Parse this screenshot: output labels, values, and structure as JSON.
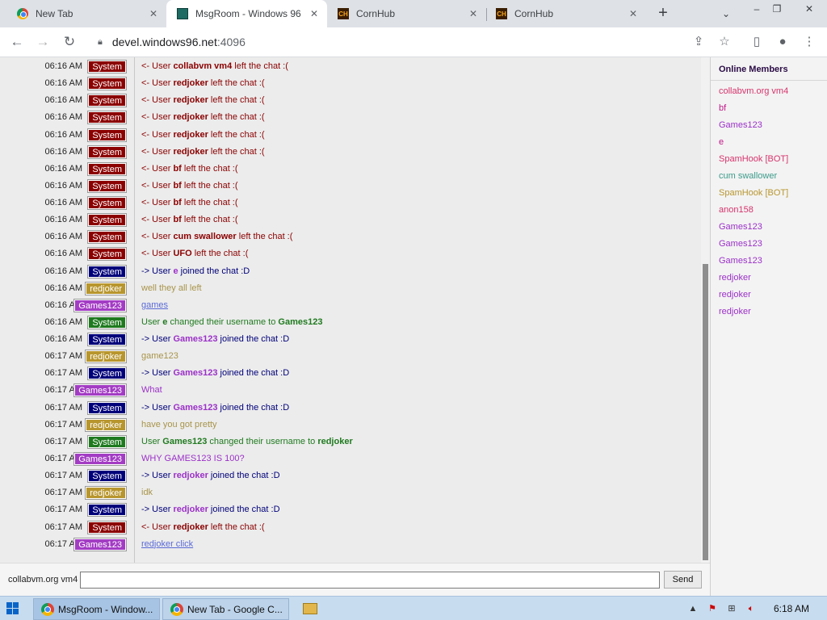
{
  "browser": {
    "tabs": [
      {
        "title": "New Tab",
        "favicon": "chrome-icon",
        "active": false
      },
      {
        "title": "MsgRoom - Windows 96",
        "favicon": "windows96-icon",
        "active": true
      },
      {
        "title": "CornHub",
        "favicon": "ch-icon",
        "active": false
      },
      {
        "title": "CornHub",
        "favicon": "ch-icon",
        "active": false
      }
    ],
    "url_host": "devel.windows96.net",
    "url_port": ":4096"
  },
  "chat": {
    "messages": [
      {
        "time": "06:16 AM",
        "sender": "System",
        "badge_color": "#8b0000",
        "text_color": "#8b0000",
        "parts": [
          {
            "t": "<- User "
          },
          {
            "t": "collabvm vm4",
            "b": true
          },
          {
            "t": " left the chat :("
          }
        ]
      },
      {
        "time": "06:16 AM",
        "sender": "System",
        "badge_color": "#8b0000",
        "text_color": "#8b0000",
        "parts": [
          {
            "t": "<- User "
          },
          {
            "t": "redjoker",
            "b": true
          },
          {
            "t": " left the chat :("
          }
        ]
      },
      {
        "time": "06:16 AM",
        "sender": "System",
        "badge_color": "#8b0000",
        "text_color": "#8b0000",
        "parts": [
          {
            "t": "<- User "
          },
          {
            "t": "redjoker",
            "b": true
          },
          {
            "t": " left the chat :("
          }
        ]
      },
      {
        "time": "06:16 AM",
        "sender": "System",
        "badge_color": "#8b0000",
        "text_color": "#8b0000",
        "parts": [
          {
            "t": "<- User "
          },
          {
            "t": "redjoker",
            "b": true
          },
          {
            "t": " left the chat :("
          }
        ]
      },
      {
        "time": "06:16 AM",
        "sender": "System",
        "badge_color": "#8b0000",
        "text_color": "#8b0000",
        "parts": [
          {
            "t": "<- User "
          },
          {
            "t": "redjoker",
            "b": true
          },
          {
            "t": " left the chat :("
          }
        ]
      },
      {
        "time": "06:16 AM",
        "sender": "System",
        "badge_color": "#8b0000",
        "text_color": "#8b0000",
        "parts": [
          {
            "t": "<- User "
          },
          {
            "t": "redjoker",
            "b": true
          },
          {
            "t": " left the chat :("
          }
        ]
      },
      {
        "time": "06:16 AM",
        "sender": "System",
        "badge_color": "#8b0000",
        "text_color": "#8b0000",
        "parts": [
          {
            "t": "<- User "
          },
          {
            "t": "bf",
            "b": true
          },
          {
            "t": " left the chat :("
          }
        ]
      },
      {
        "time": "06:16 AM",
        "sender": "System",
        "badge_color": "#8b0000",
        "text_color": "#8b0000",
        "parts": [
          {
            "t": "<- User "
          },
          {
            "t": "bf",
            "b": true
          },
          {
            "t": " left the chat :("
          }
        ]
      },
      {
        "time": "06:16 AM",
        "sender": "System",
        "badge_color": "#8b0000",
        "text_color": "#8b0000",
        "parts": [
          {
            "t": "<- User "
          },
          {
            "t": "bf",
            "b": true
          },
          {
            "t": " left the chat :("
          }
        ]
      },
      {
        "time": "06:16 AM",
        "sender": "System",
        "badge_color": "#8b0000",
        "text_color": "#8b0000",
        "parts": [
          {
            "t": "<- User "
          },
          {
            "t": "bf",
            "b": true
          },
          {
            "t": " left the chat :("
          }
        ]
      },
      {
        "time": "06:16 AM",
        "sender": "System",
        "badge_color": "#8b0000",
        "text_color": "#8b0000",
        "parts": [
          {
            "t": "<- User "
          },
          {
            "t": "cum swallower",
            "b": true
          },
          {
            "t": " left the chat :("
          }
        ]
      },
      {
        "time": "06:16 AM",
        "sender": "System",
        "badge_color": "#8b0000",
        "text_color": "#8b0000",
        "parts": [
          {
            "t": "<- User "
          },
          {
            "t": "UFO",
            "b": true
          },
          {
            "t": " left the chat :("
          }
        ]
      },
      {
        "time": "06:16 AM",
        "sender": "System",
        "badge_color": "#00007a",
        "text_color": "#00007a",
        "parts": [
          {
            "t": "-> User "
          },
          {
            "t": "e",
            "b": true,
            "c": "#9b30c8"
          },
          {
            "t": " joined the chat :D"
          }
        ]
      },
      {
        "time": "06:16 AM",
        "sender": "redjoker",
        "badge_color": "#b8962e",
        "text_color": "#a8944a",
        "parts": [
          {
            "t": "well they all left"
          }
        ]
      },
      {
        "time": "06:16 AM",
        "sender": "Games123",
        "badge_color": "#a33cc4",
        "text_color": "#5a6ad6",
        "parts": [
          {
            "t": "games",
            "u": true
          }
        ]
      },
      {
        "time": "06:16 AM",
        "sender": "System",
        "badge_color": "#1f7a1f",
        "text_color": "#1f7a1f",
        "parts": [
          {
            "t": "User "
          },
          {
            "t": "e",
            "b": true
          },
          {
            "t": " changed their username to "
          },
          {
            "t": "Games123",
            "b": true
          }
        ]
      },
      {
        "time": "06:16 AM",
        "sender": "System",
        "badge_color": "#00007a",
        "text_color": "#00007a",
        "parts": [
          {
            "t": "-> User "
          },
          {
            "t": "Games123",
            "b": true,
            "c": "#9b30c8"
          },
          {
            "t": " joined the chat :D"
          }
        ]
      },
      {
        "time": "06:17 AM",
        "sender": "redjoker",
        "badge_color": "#b8962e",
        "text_color": "#a8944a",
        "parts": [
          {
            "t": "game123"
          }
        ]
      },
      {
        "time": "06:17 AM",
        "sender": "System",
        "badge_color": "#00007a",
        "text_color": "#00007a",
        "parts": [
          {
            "t": "-> User "
          },
          {
            "t": "Games123",
            "b": true,
            "c": "#9b30c8"
          },
          {
            "t": " joined the chat :D"
          }
        ]
      },
      {
        "time": "06:17 AM",
        "sender": "Games123",
        "badge_color": "#a33cc4",
        "text_color": "#9b30c8",
        "parts": [
          {
            "t": "What"
          }
        ]
      },
      {
        "time": "06:17 AM",
        "sender": "System",
        "badge_color": "#00007a",
        "text_color": "#00007a",
        "parts": [
          {
            "t": "-> User "
          },
          {
            "t": "Games123",
            "b": true,
            "c": "#9b30c8"
          },
          {
            "t": " joined the chat :D"
          }
        ]
      },
      {
        "time": "06:17 AM",
        "sender": "redjoker",
        "badge_color": "#b8962e",
        "text_color": "#a8944a",
        "parts": [
          {
            "t": "have you got pretty"
          }
        ]
      },
      {
        "time": "06:17 AM",
        "sender": "System",
        "badge_color": "#1f7a1f",
        "text_color": "#1f7a1f",
        "parts": [
          {
            "t": "User "
          },
          {
            "t": "Games123",
            "b": true
          },
          {
            "t": " changed their username to "
          },
          {
            "t": "redjoker",
            "b": true
          }
        ]
      },
      {
        "time": "06:17 AM",
        "sender": "Games123",
        "badge_color": "#a33cc4",
        "text_color": "#9b30c8",
        "parts": [
          {
            "t": "WHY GAMES123 IS 100?"
          }
        ]
      },
      {
        "time": "06:17 AM",
        "sender": "System",
        "badge_color": "#00007a",
        "text_color": "#00007a",
        "parts": [
          {
            "t": "-> User "
          },
          {
            "t": "redjoker",
            "b": true,
            "c": "#9b30c8"
          },
          {
            "t": " joined the chat :D"
          }
        ]
      },
      {
        "time": "06:17 AM",
        "sender": "redjoker",
        "badge_color": "#b8962e",
        "text_color": "#a8944a",
        "parts": [
          {
            "t": "idk"
          }
        ]
      },
      {
        "time": "06:17 AM",
        "sender": "System",
        "badge_color": "#00007a",
        "text_color": "#00007a",
        "parts": [
          {
            "t": "-> User "
          },
          {
            "t": "redjoker",
            "b": true,
            "c": "#9b30c8"
          },
          {
            "t": " joined the chat :D"
          }
        ]
      },
      {
        "time": "06:17 AM",
        "sender": "System",
        "badge_color": "#8b0000",
        "text_color": "#8b0000",
        "parts": [
          {
            "t": "<- User "
          },
          {
            "t": "redjoker",
            "b": true
          },
          {
            "t": " left the chat :("
          }
        ]
      },
      {
        "time": "06:17 AM",
        "sender": "Games123",
        "badge_color": "#a33cc4",
        "text_color": "#5a6ad6",
        "parts": [
          {
            "t": "redjoker click",
            "u": true
          }
        ]
      }
    ]
  },
  "members": {
    "title": "Online Members",
    "list": [
      {
        "name": "collabvm.org vm4",
        "color": "#d6336c"
      },
      {
        "name": "bf",
        "color": "#c2188a"
      },
      {
        "name": "Games123",
        "color": "#9b30c8"
      },
      {
        "name": "e",
        "color": "#c2188a"
      },
      {
        "name": "SpamHook [BOT]",
        "color": "#d6336c"
      },
      {
        "name": "cum swallower",
        "color": "#3c9b8a"
      },
      {
        "name": "SpamHook [BOT]",
        "color": "#b8962e"
      },
      {
        "name": "anon158",
        "color": "#d6336c"
      },
      {
        "name": "Games123",
        "color": "#9b30c8"
      },
      {
        "name": "Games123",
        "color": "#9b30c8"
      },
      {
        "name": "Games123",
        "color": "#9b30c8"
      },
      {
        "name": "redjoker",
        "color": "#9b30c8"
      },
      {
        "name": "redjoker",
        "color": "#9b30c8"
      },
      {
        "name": "redjoker",
        "color": "#9b30c8"
      }
    ]
  },
  "input": {
    "nickname": "collabvm.org vm4",
    "value": "",
    "send_label": "Send"
  },
  "taskbar": {
    "tasks": [
      {
        "title": "MsgRoom - Window...",
        "active": true
      },
      {
        "title": "New Tab - Google C...",
        "active": false
      }
    ],
    "clock": "6:18 AM"
  }
}
